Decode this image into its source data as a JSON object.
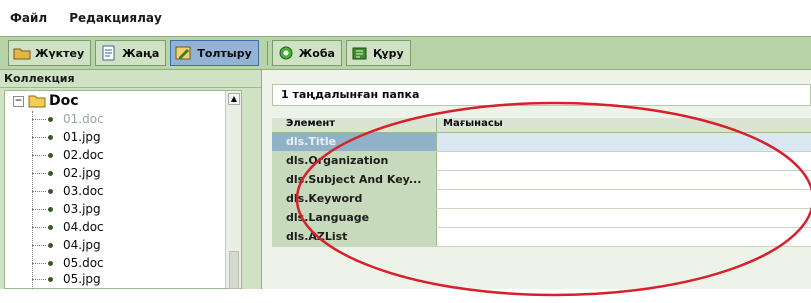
{
  "menu": {
    "items": [
      "Файл",
      "Редакциялау"
    ]
  },
  "toolbar": {
    "buttons": [
      {
        "label": "Жүктеу",
        "icon": "folder-open-icon"
      },
      {
        "label": "Жаңа",
        "icon": "new-document-icon"
      },
      {
        "label": "Толтыру",
        "icon": "edit-form-icon",
        "active": true
      },
      {
        "label": "Жоба",
        "icon": "project-icon"
      },
      {
        "label": "Құру",
        "icon": "build-icon"
      }
    ]
  },
  "collection": {
    "title": "Коллекция",
    "root": {
      "label": "Doc",
      "expander": "−"
    },
    "items": [
      "01.doc",
      "01.jpg",
      "02.doc",
      "02.jpg",
      "03.doc",
      "03.jpg",
      "04.doc",
      "04.jpg",
      "05.doc",
      "05.jpg"
    ],
    "selected_index": 0
  },
  "details": {
    "header": "1 таңдалынған папка",
    "columns": [
      "Элемент",
      "Мағынасы"
    ],
    "rows": [
      {
        "element": "dls.Title",
        "value": "",
        "selected": true
      },
      {
        "element": "dls.Organization",
        "value": ""
      },
      {
        "element": "dls.Subject And Key...",
        "value": ""
      },
      {
        "element": "dls.Keyword",
        "value": ""
      },
      {
        "element": "dls.Language",
        "value": ""
      },
      {
        "element": "dls.AZList",
        "value": ""
      }
    ]
  },
  "colors": {
    "panel_green": "#cfe2c3",
    "toolbar_green": "#b9d3a9",
    "active_button": "#93b3d6",
    "annotation_ellipse": "#d8202a"
  }
}
